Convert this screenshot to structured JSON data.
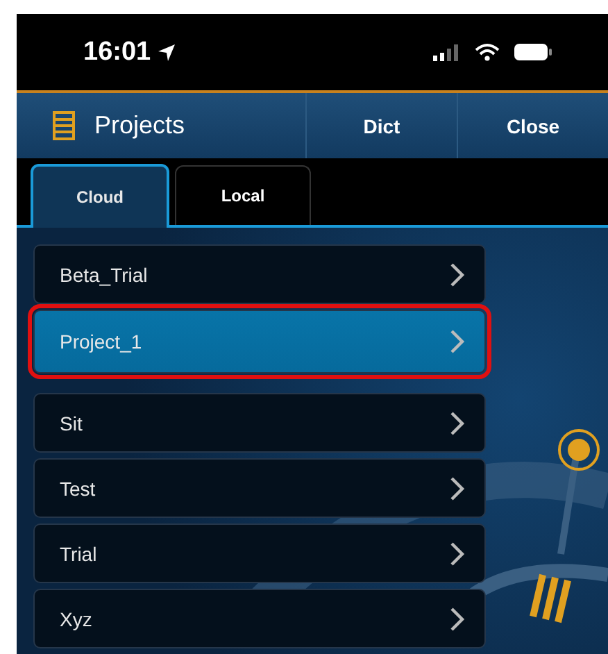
{
  "status_bar": {
    "time": "16:01"
  },
  "header": {
    "title": "Projects",
    "buttons": [
      "Dict",
      "Close"
    ]
  },
  "tabs": [
    {
      "label": "Cloud",
      "selected": true
    },
    {
      "label": "Local",
      "selected": false
    }
  ],
  "projects": [
    {
      "name": "Beta_Trial",
      "selected": false
    },
    {
      "name": "Project_1",
      "selected": true
    },
    {
      "name": "Sit",
      "selected": false
    },
    {
      "name": "Test",
      "selected": false
    },
    {
      "name": "Trial",
      "selected": false
    },
    {
      "name": "Xyz",
      "selected": false
    }
  ]
}
